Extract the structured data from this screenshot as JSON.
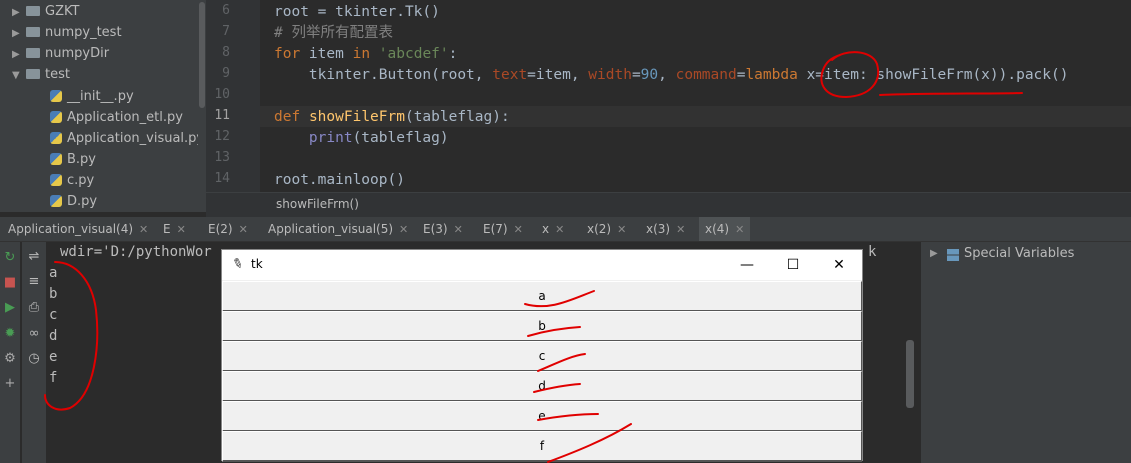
{
  "project_tree": {
    "items": [
      {
        "label": "GZKT",
        "type": "folder",
        "expanded": false
      },
      {
        "label": "numpy_test",
        "type": "folder",
        "expanded": false
      },
      {
        "label": "numpyDir",
        "type": "folder",
        "expanded": false
      },
      {
        "label": "test",
        "type": "folder",
        "expanded": true
      },
      {
        "label": "__init__.py",
        "type": "file"
      },
      {
        "label": "Application_etl.py",
        "type": "file"
      },
      {
        "label": "Application_visual.py",
        "type": "file"
      },
      {
        "label": "B.py",
        "type": "file"
      },
      {
        "label": "c.py",
        "type": "file"
      },
      {
        "label": "D.py",
        "type": "file"
      }
    ]
  },
  "editor": {
    "line_numbers": [
      "6",
      "7",
      "8",
      "9",
      "10",
      "11",
      "12",
      "13",
      "14"
    ],
    "breadcrumb": "showFileFrm()"
  },
  "run_tabs": [
    "Application_visual(4)",
    "E",
    "E(2)",
    "Application_visual(5)",
    "E(3)",
    "E(7)",
    "x",
    "x(2)",
    "x(3)",
    "x(4)"
  ],
  "console": {
    "first_line": "wdir='D:/pythonWor",
    "first_line_tail": "k",
    "output": [
      "a",
      "b",
      "c",
      "d",
      "e",
      "f"
    ]
  },
  "variables_panel": {
    "label": "Special Variables"
  },
  "tk_window": {
    "title": "tk",
    "controls": {
      "minimize": "—",
      "maximize": "☐",
      "close": "✕"
    },
    "buttons": [
      "a",
      "b",
      "c",
      "d",
      "e",
      "f"
    ]
  },
  "colors": {
    "annotation": "#e00000",
    "ide_bg": "#2b2b2b",
    "panel_bg": "#3c3f41"
  }
}
